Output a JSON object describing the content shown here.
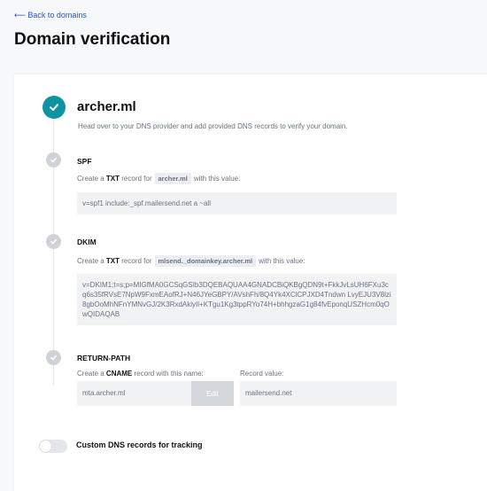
{
  "header": {
    "back_link": "⟵ Back to domains",
    "title": "Domain verification"
  },
  "domain": {
    "name": "archer.ml",
    "instructions": "Head over to your DNS provider and add provided DNS records to verify your domain."
  },
  "spf": {
    "title": "SPF",
    "prefix": "Create a",
    "type": "TXT",
    "middle": "record for",
    "host": "archer.ml",
    "suffix": "with this value:",
    "value": "v=spf1 include:_spf.mailersend.net a ~all"
  },
  "dkim": {
    "title": "DKIM",
    "prefix": "Create a",
    "type": "TXT",
    "middle": "record for",
    "host": "mlsend._domainkey.archer.ml",
    "suffix": "with this value:",
    "value": "v=DKIM1;t=s;p=MIGfMA0GCSqGSIb3DQEBAQUAA4GNADCBiQKBgQDN9t+FkkJvLsUH6FXu3cq6s35fRVsE7NpW9FxmEAofRJ+N46JYeGBPY/AVshFh/8Q4Yk4XClCPJXD4Tndwn LvyEJU3V8lzi8gbOoMhNFnYMNvGJ/2K3RxdAkiyIl+KTgu1Kg3tppRYo74H+bhhgzaG1g84fvEponqUSZHcm0qOwQIDAQAB"
  },
  "return_path": {
    "title": "RETURN-PATH",
    "prefix": "Create a",
    "type": "CNAME",
    "suffix": "record with this name:",
    "value_label": "Record value:",
    "name_value": "mta.archer.ml",
    "edit_label": "Edit",
    "record_value": "mailersend.net"
  },
  "tracking": {
    "label": "Custom DNS records for tracking",
    "enabled": false
  },
  "colors": {
    "accent": "#0e93a3",
    "link": "#2456c9",
    "pending": "#cfd3d8"
  }
}
